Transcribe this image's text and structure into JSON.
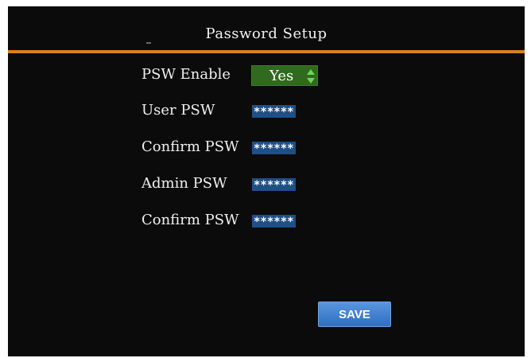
{
  "header": {
    "title": "Password Setup"
  },
  "form": {
    "psw_enable": {
      "label": "PSW Enable",
      "value": "Yes"
    },
    "user_psw": {
      "label": "User PSW",
      "value": "******"
    },
    "user_confirm": {
      "label": "Confirm PSW",
      "value": "******"
    },
    "admin_psw": {
      "label": "Admin PSW",
      "value": "******"
    },
    "admin_confirm": {
      "label": "Confirm PSW",
      "value": "******"
    }
  },
  "actions": {
    "save_label": "SAVE"
  },
  "colors": {
    "background": "#0b0b0b",
    "divider": "#d8801e",
    "field_bg": "#1e4f86",
    "select_bg": "#2f6a1e",
    "spinner": "#6dd65a",
    "button": "#3a7fd0"
  },
  "icons": {
    "spinner": "up-down-arrows-icon"
  }
}
